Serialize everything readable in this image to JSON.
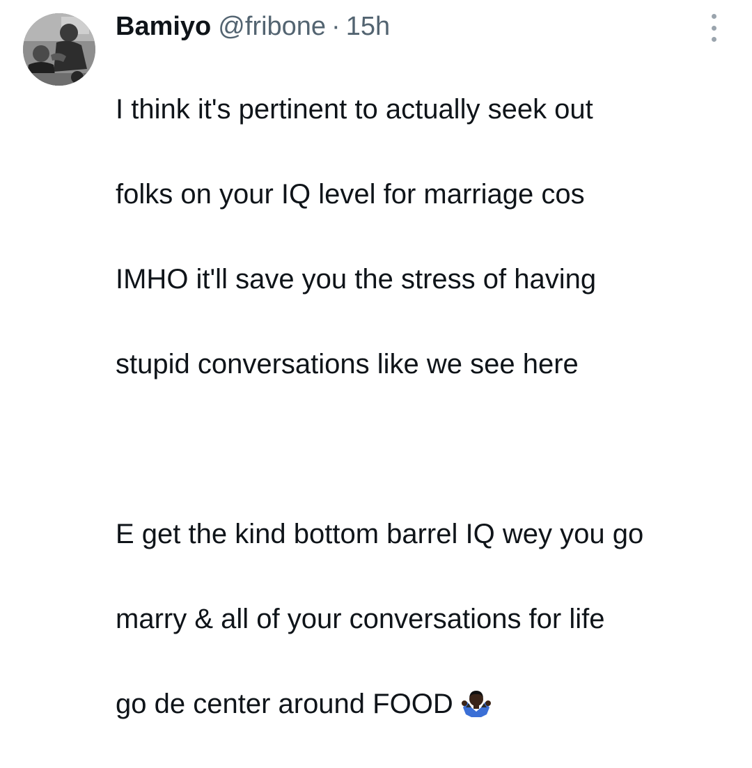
{
  "tweet": {
    "author_name": "Bamiyo",
    "handle": "@fribone",
    "separator": "·",
    "time": "15h",
    "lines": [
      "I think it's pertinent to actually seek out",
      "folks on your IQ level for marriage cos",
      "IMHO it'll save you the stress of having",
      "stupid conversations like we see here"
    ],
    "lines2": [
      "E get the kind bottom barrel IQ wey you go",
      "marry & all of your conversations for life",
      "go de center around FOOD"
    ],
    "end_emoji": "person-shrugging-emoji",
    "more_icon": "more-options-icon",
    "avatar": "user-avatar"
  },
  "colors": {
    "text_primary": "#0f1419",
    "text_secondary": "#536471",
    "background": "#ffffff"
  }
}
